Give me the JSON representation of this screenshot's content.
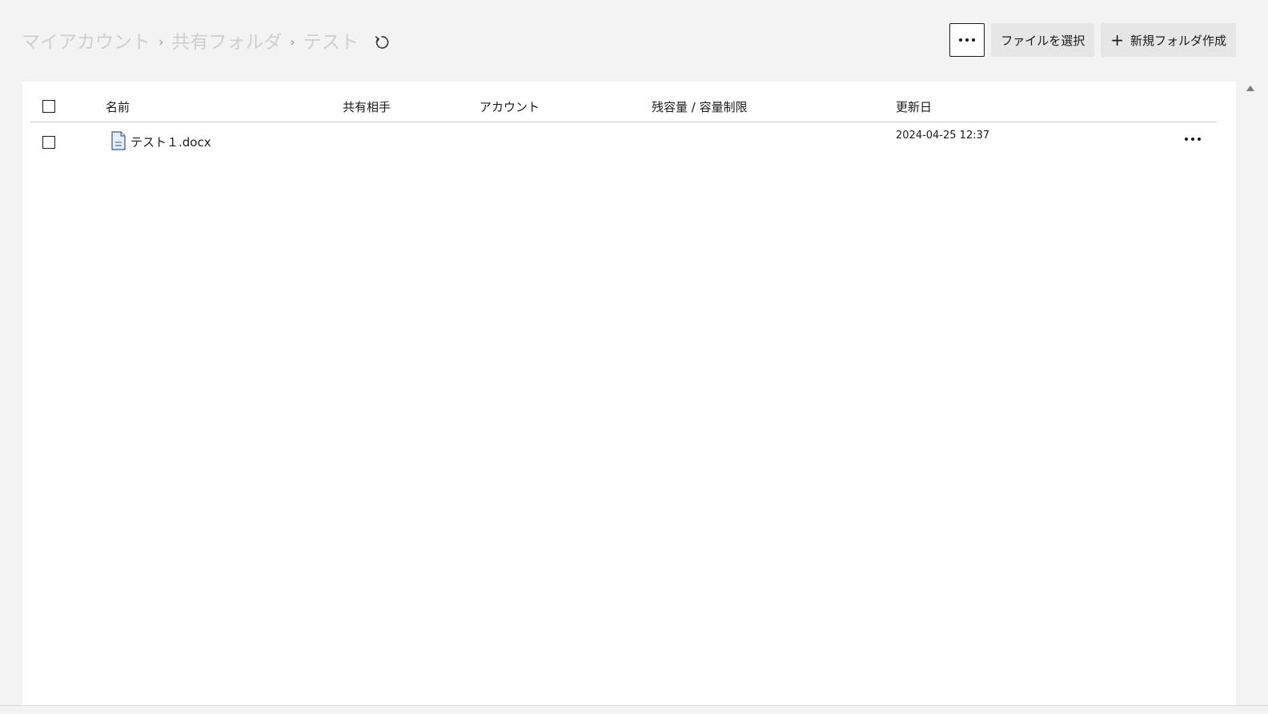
{
  "breadcrumb": {
    "items": [
      "マイアカウント",
      "共有フォルダ",
      "テスト"
    ],
    "separator": "›",
    "refresh_icon": "refresh-icon"
  },
  "toolbar": {
    "more_icon": "more-horizontal-icon",
    "select_file_label": "ファイルを選択",
    "new_folder_label": "新規フォルダ作成",
    "new_folder_icon": "plus-icon"
  },
  "table": {
    "columns": [
      "名前",
      "共有相手",
      "アカウント",
      "残容量 / 容量制限",
      "更新日"
    ],
    "rows": [
      {
        "name": "テスト１.docx",
        "icon": "word-document-icon",
        "shared_with": "",
        "account": "",
        "quota": "",
        "updated": "2024-04-25 12:37",
        "menu_icon": "more-horizontal-icon"
      }
    ]
  },
  "colors": {
    "background": "#f3f3f3",
    "panel": "#ffffff",
    "breadcrumb_text": "#cfcfcf",
    "button_bg": "#e6e6e6",
    "doc_icon": "#2b579a"
  }
}
